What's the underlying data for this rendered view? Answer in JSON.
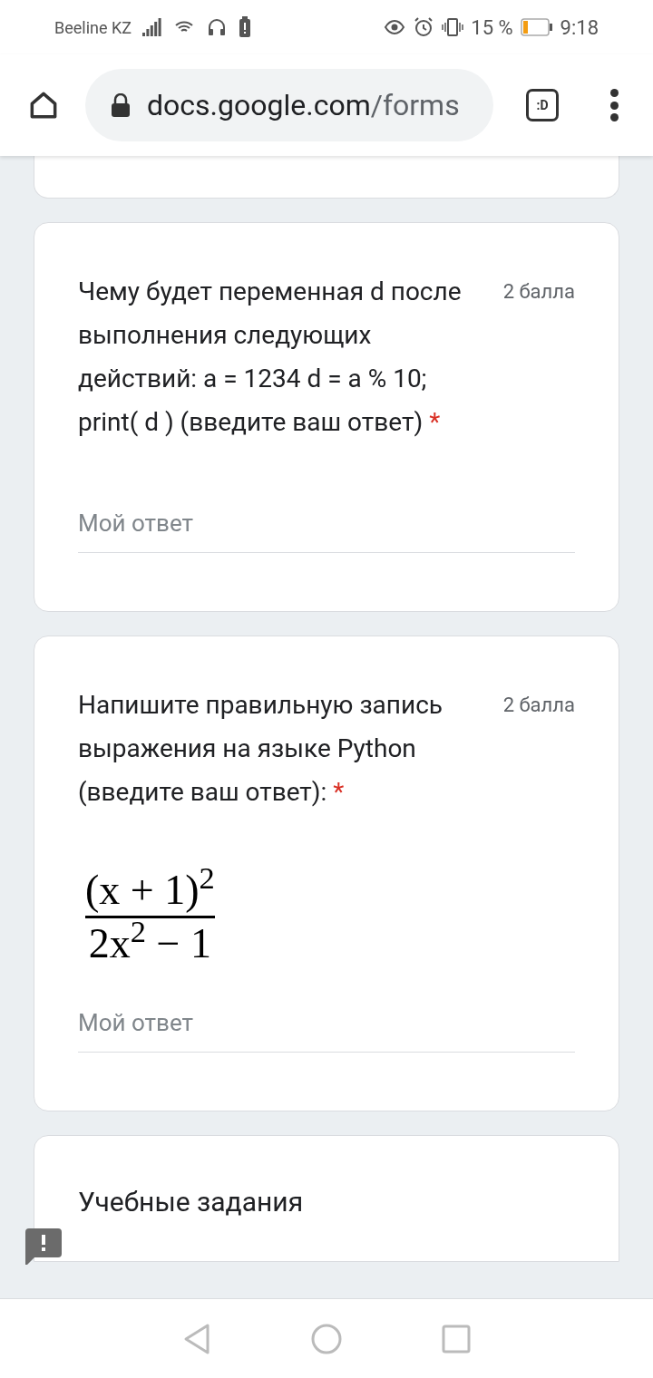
{
  "status_bar": {
    "carrier": "Beeline KZ",
    "battery_percent": "15 %",
    "time": "9:18"
  },
  "browser": {
    "url_host": "docs.google.com",
    "url_path": "/forms",
    "tab_button": ":D"
  },
  "questions": [
    {
      "text": "Чему будет переменная d после выполнения следующих действий: a = 1234 d = a % 10; print( d ) (введите ваш ответ)",
      "required_mark": "*",
      "points": "2 балла",
      "placeholder": "Мой ответ"
    },
    {
      "text": "Напишите правильную запись выражения на языке Python (введите ваш ответ):",
      "required_mark": "*",
      "points": "2 балла",
      "formula": {
        "numerator": "(x + 1)$^{2}$",
        "denominator": "2x$^{2}$ − 1"
      },
      "placeholder": "Мой ответ"
    }
  ],
  "section": {
    "title": "Учебные задания"
  }
}
